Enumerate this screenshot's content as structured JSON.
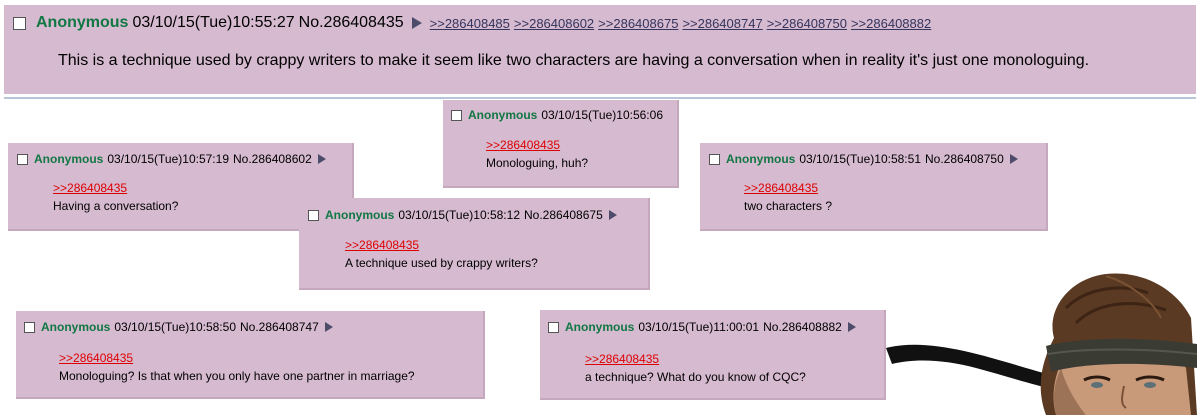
{
  "op": {
    "name": "Anonymous",
    "datetime": "03/10/15(Tue)10:55:27",
    "post_no": "No.286408435",
    "backlinks": [
      ">>286408485",
      ">>286408602",
      ">>286408675",
      ">>286408747",
      ">>286408750",
      ">>286408882"
    ],
    "comment": "This is a technique used by crappy writers to make it seem like two characters are having a conversation when in reality it's just one monologuing."
  },
  "replies": [
    {
      "name": "Anonymous",
      "datetime": "03/10/15(Tue)10:56:06",
      "post_no": "",
      "quote": ">>286408435",
      "comment": "Monologuing, huh?"
    },
    {
      "name": "Anonymous",
      "datetime": "03/10/15(Tue)10:57:19",
      "post_no": "No.286408602",
      "quote": ">>286408435",
      "comment": "Having a conversation?"
    },
    {
      "name": "Anonymous",
      "datetime": "03/10/15(Tue)10:58:51",
      "post_no": "No.286408750",
      "quote": ">>286408435",
      "comment": "two characters ?"
    },
    {
      "name": "Anonymous",
      "datetime": "03/10/15(Tue)10:58:12",
      "post_no": "No.286408675",
      "quote": ">>286408435",
      "comment": "A technique used by crappy writers?"
    },
    {
      "name": "Anonymous",
      "datetime": "03/10/15(Tue)10:58:50",
      "post_no": "No.286408747",
      "quote": ">>286408435",
      "comment": "Monologuing? Is that when you only have one partner in marriage?"
    },
    {
      "name": "Anonymous",
      "datetime": "03/10/15(Tue)11:00:01",
      "post_no": "No.286408882",
      "quote": ">>286408435",
      "comment": "a technique? What do you know of CQC?"
    }
  ],
  "colors": {
    "post_bg": "#d6bad0",
    "name": "#117743",
    "quote_link": "#dd0000",
    "backlink": "#34345c"
  }
}
